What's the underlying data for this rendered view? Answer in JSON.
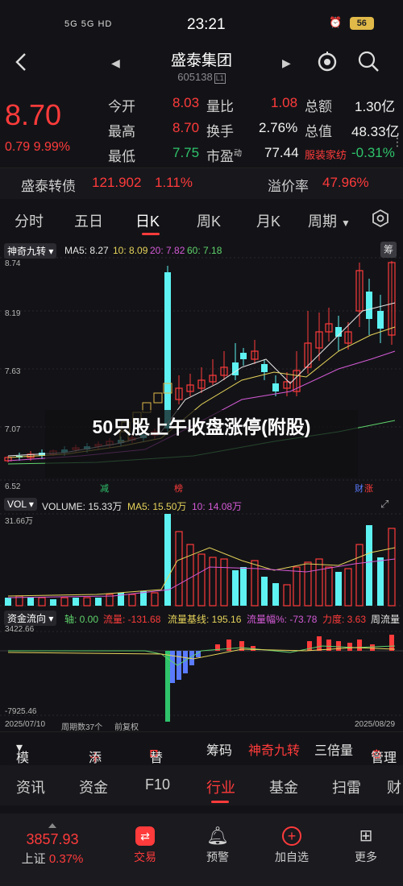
{
  "status": {
    "time": "23:21",
    "left_icons": "5G 5G HD",
    "battery": "56"
  },
  "header": {
    "name": "盛泰集团",
    "code": "605138",
    "code_tag": "L1"
  },
  "quote": {
    "price": "8.70",
    "change": "0.79",
    "change_pct": "9.99%",
    "open_label": "今开",
    "open": "8.03",
    "high_label": "最高",
    "high": "8.70",
    "low_label": "最低",
    "low": "7.75",
    "vol_ratio_label": "量比",
    "vol_ratio": "1.08",
    "turnover_label": "换手",
    "turnover": "2.76%",
    "pe_label": "市盈",
    "pe_sup": "动",
    "pe": "77.44",
    "amount_label": "总额",
    "amount": "1.30亿",
    "mktcap_label": "总值",
    "mktcap": "48.33亿",
    "sector": "服装家纺",
    "sector_pct": "-0.31%"
  },
  "bond": {
    "name": "盛泰转债",
    "price": "121.902",
    "pct": "1.11%",
    "premium_label": "溢价率",
    "premium": "47.96%"
  },
  "tabs": [
    "分时",
    "五日",
    "日K",
    "周K",
    "月K",
    "周期"
  ],
  "chart": {
    "main_indicator": "神奇九转",
    "ma_legend": [
      "MA5: 8.27",
      "10: 8.09",
      "20: 7.82",
      "60: 7.18"
    ],
    "chip_label": "筹",
    "price_axis": [
      "8.74",
      "8.19",
      "7.63",
      "7.07",
      "6.52"
    ],
    "badges": [
      "减",
      "榜",
      "财",
      "涨"
    ],
    "vol_indicator": "VOL",
    "vol_legend": [
      "VOLUME: 15.33万",
      "MA5: 15.50万",
      "10: 14.08万"
    ],
    "vol_axis_top": "31.66万",
    "flow_indicator": "资金流向",
    "flow_legend": [
      "轴: 0.00",
      "流量: -131.68",
      "流量基线: 195.16",
      "流量幅%: -73.78",
      "力度: 3.63",
      "周流量"
    ],
    "flow_axis_top": "3422.66",
    "flow_axis_bottom": "-7925.46",
    "date_start": "2025/07/10",
    "period_info": "周期数37个",
    "adjust": "前复权",
    "date_end": "2025/08/29",
    "banner": "50只股上午收盘涨停(附股)"
  },
  "toolbar": {
    "template": "模板",
    "add": "添加",
    "replace": "替换",
    "chips": "筹码",
    "nine": "神奇九转",
    "triple": "三倍量",
    "manage": "管理"
  },
  "info_tabs": [
    "资讯",
    "资金",
    "F10",
    "行业",
    "基金",
    "扫雷",
    "财"
  ],
  "footer": {
    "index_value": "3857.93",
    "index_name": "上证",
    "index_pct": "0.37%",
    "trade": "交易",
    "alert": "预警",
    "add_fav": "加自选",
    "more": "更多"
  },
  "colors": {
    "up": "#ff3b3b",
    "down": "#2fc36b",
    "cyan_bar": "#5ef2f2"
  }
}
